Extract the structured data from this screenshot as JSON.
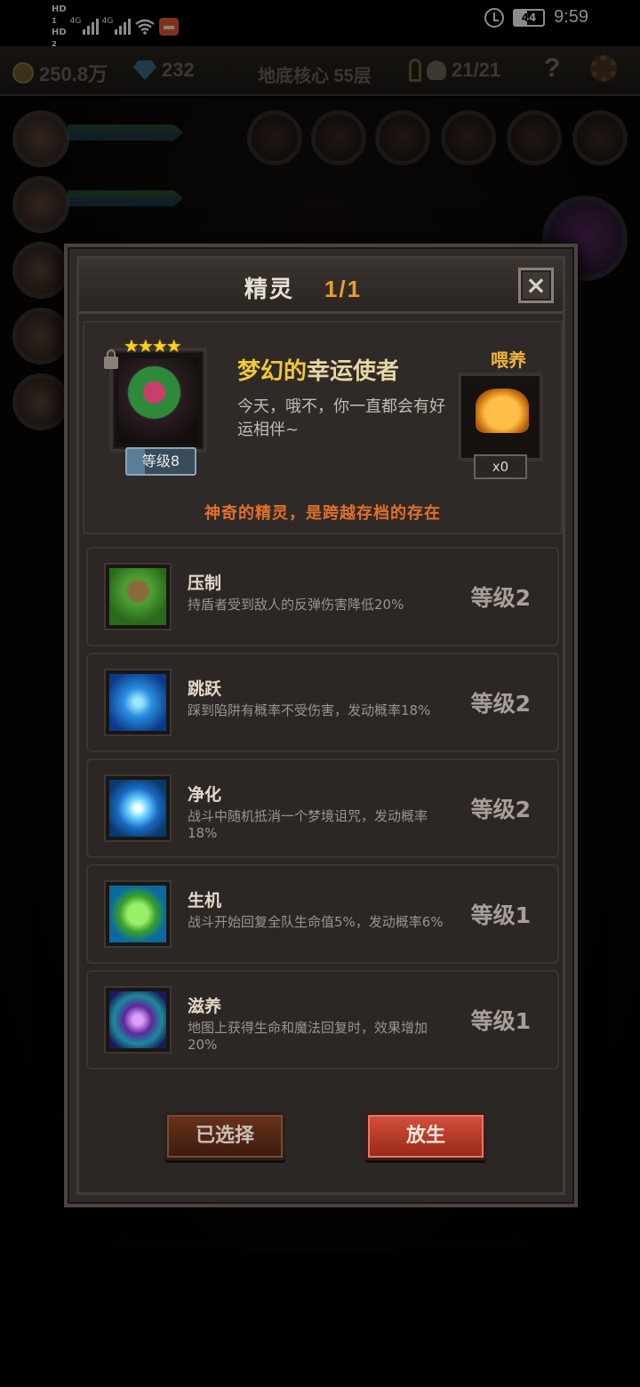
{
  "status_bar": {
    "sim1": "HD",
    "sim1_sub": "1",
    "sim2": "HD",
    "sim2_sub": "2",
    "net1": "4G",
    "net2": "4G",
    "battery": "44",
    "time": "9:59"
  },
  "hud": {
    "gold": "250.8万",
    "gems": "232",
    "floor": "地底核心 55层",
    "keys_kills": "21/21",
    "help": "?"
  },
  "dialog": {
    "title": "精灵",
    "count": "1/1",
    "close_label": "×",
    "spirit": {
      "stars": "★★★★",
      "level": "等级8",
      "name_part1": "梦幻的",
      "name_part2": "幸运使者",
      "description": "今天，哦不，你一直都会有好运相伴~",
      "feed_label": "喂养",
      "feed_count": "x0",
      "note": "神奇的精灵，是跨越存档的存在"
    },
    "skills": [
      {
        "name": "压制",
        "desc": "持盾者受到敌人的反弹伤害降低20%",
        "level": "等级2",
        "icon": "claw-grass-icon"
      },
      {
        "name": "跳跃",
        "desc": "踩到陷阱有概率不受伤害，发动概率18%",
        "level": "等级2",
        "icon": "leap-water-icon"
      },
      {
        "name": "净化",
        "desc": "战斗中随机抵消一个梦境诅咒，发动概率18%",
        "level": "等级2",
        "icon": "blue-flower-icon"
      },
      {
        "name": "生机",
        "desc": "战斗开始回复全队生命值5%，发动概率6%",
        "level": "等级1",
        "icon": "green-leaf-icon"
      },
      {
        "name": "滋养",
        "desc": "地图上获得生命和魔法回复时，效果增加20%",
        "level": "等级1",
        "icon": "butterfly-wings-icon"
      }
    ],
    "btn_selected": "已选择",
    "btn_release": "放生"
  }
}
